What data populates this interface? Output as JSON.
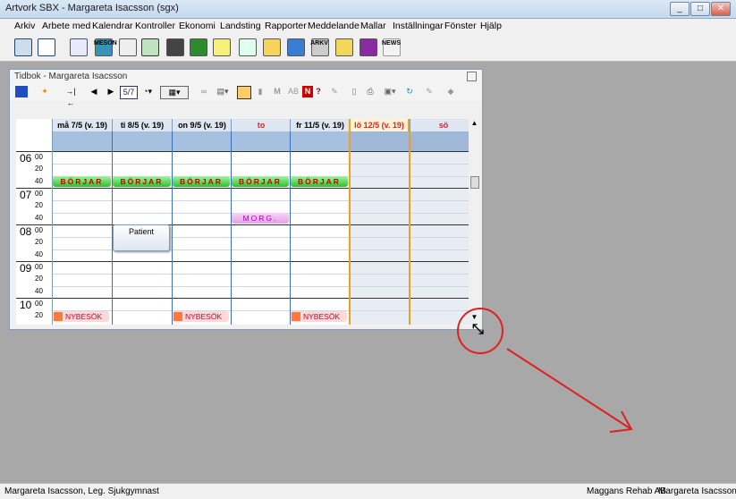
{
  "window": {
    "title": "Artvork SBX - Margareta Isacsson (sgx)",
    "min": "_",
    "max": "□",
    "close": "✕"
  },
  "menu": [
    "Arkiv",
    "Arbete med",
    "Kalendrar",
    "Kontroller",
    "Ekonomi",
    "Landsting",
    "Rapporter",
    "Meddelande",
    "Mallar",
    "Inställningar",
    "Fönster",
    "Hjälp"
  ],
  "toolbar_icons": [
    "new-patient-icon",
    "calendar-icon",
    "copy-documents-icon",
    "meson-icon",
    "journal-icon",
    "monitor-icon",
    "phone-icon",
    "cash-icon",
    "notes-icon",
    "documents-icon",
    "payment-icon",
    "folder-icon",
    "archive-icon",
    "clipboard-icon",
    "book-icon",
    "news-icon"
  ],
  "toolbar_labels": {
    "meson": "MESON",
    "arkiv": "ARKV",
    "news": "NEWS"
  },
  "tidbok": {
    "title": "Tidbok - Margareta Isacsson",
    "week_indicator": "5/7",
    "days": [
      {
        "label": "må 7/5 (v. 19)",
        "red": false
      },
      {
        "label": "ti 8/5 (v. 19)",
        "red": false
      },
      {
        "label": "on 9/5 (v. 19)",
        "red": false
      },
      {
        "label": "to",
        "red": true
      },
      {
        "label": "fr 11/5 (v. 19)",
        "red": false
      },
      {
        "label": "lö 12/5 (v. 19)",
        "red": true
      },
      {
        "label": "sö",
        "red": true
      }
    ],
    "hours": [
      "06",
      "07",
      "08",
      "09",
      "10"
    ],
    "minutes": [
      "00",
      "20",
      "40"
    ],
    "appointments": {
      "borjar": "BÖRJAR",
      "morg": "MORG.",
      "patient": "Patient",
      "nybesok": "NYBESÖK"
    }
  },
  "statusbar": {
    "left": "Margareta Isacsson, Leg. Sjukgymnast",
    "company": "Maggans Rehab AB",
    "user": "Margareta Isacsson"
  },
  "colors": {
    "annotation": "#e02020"
  }
}
